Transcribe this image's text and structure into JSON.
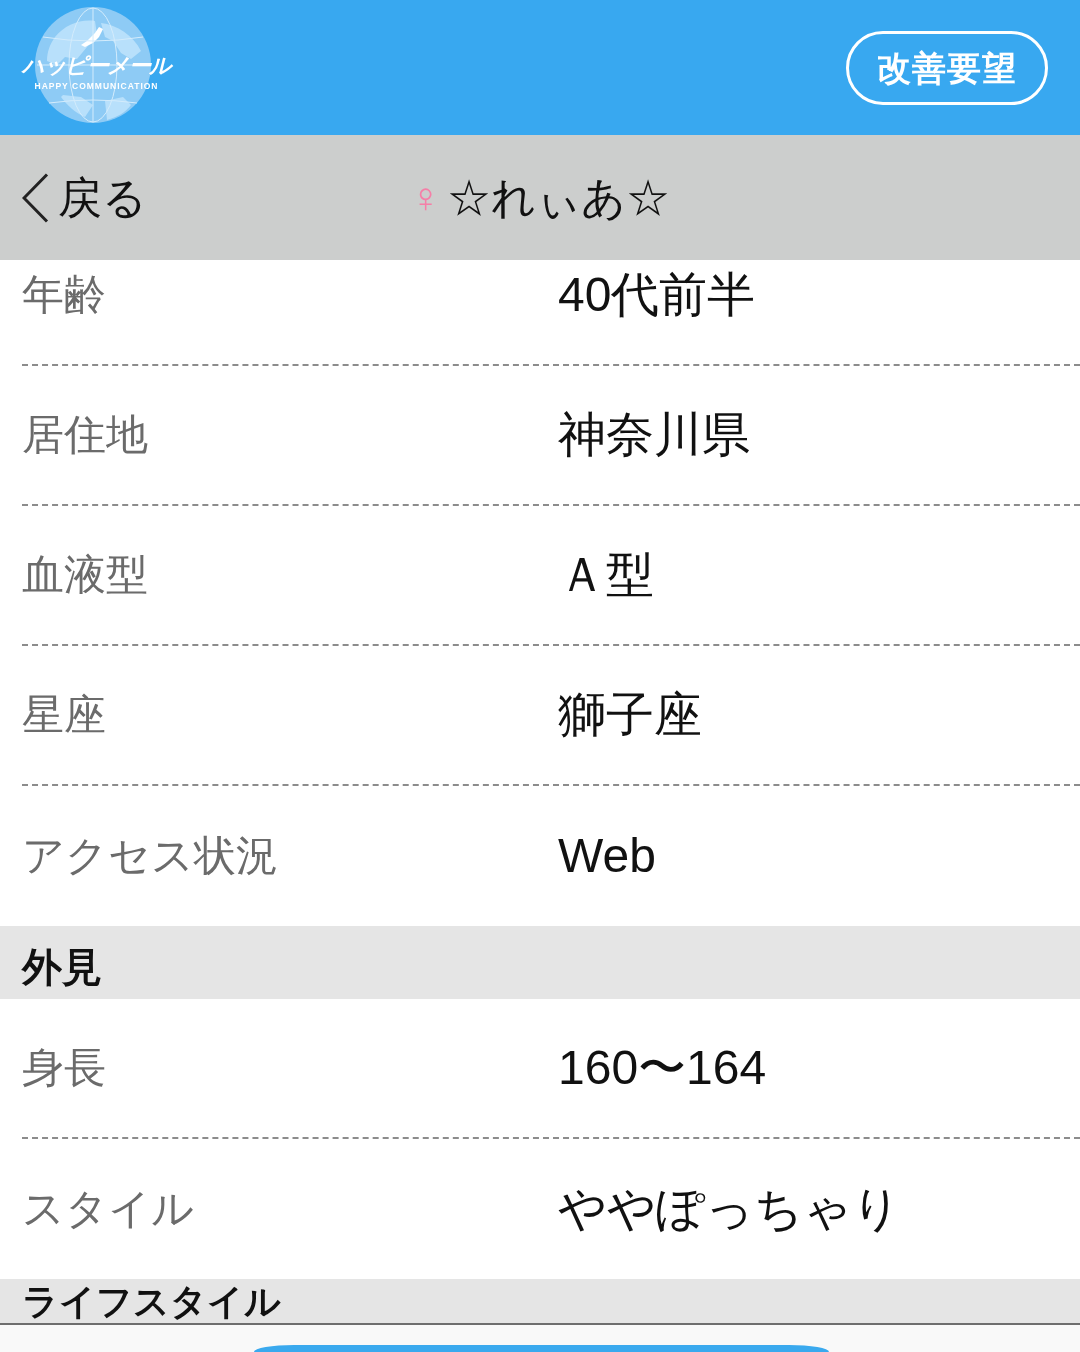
{
  "header": {
    "logo": {
      "title": "ハッピーメール",
      "subtitle": "HAPPY COMMUNICATION"
    },
    "feedback_button": "改善要望"
  },
  "nav": {
    "back_label": "戻る",
    "gender_symbol": "♀",
    "title": "☆れぃあ☆"
  },
  "sections": [
    {
      "rows": [
        {
          "label": "年齢",
          "value": "40代前半"
        },
        {
          "label": "居住地",
          "value": "神奈川県"
        },
        {
          "label": "血液型",
          "value": "Ａ型"
        },
        {
          "label": "星座",
          "value": "獅子座"
        },
        {
          "label": "アクセス状況",
          "value": "Web"
        }
      ]
    },
    {
      "heading": "外見",
      "rows": [
        {
          "label": "身長",
          "value": "160〜164"
        },
        {
          "label": "スタイル",
          "value": "ややぽっちゃり"
        }
      ]
    },
    {
      "heading": "ライフスタイル"
    }
  ]
}
